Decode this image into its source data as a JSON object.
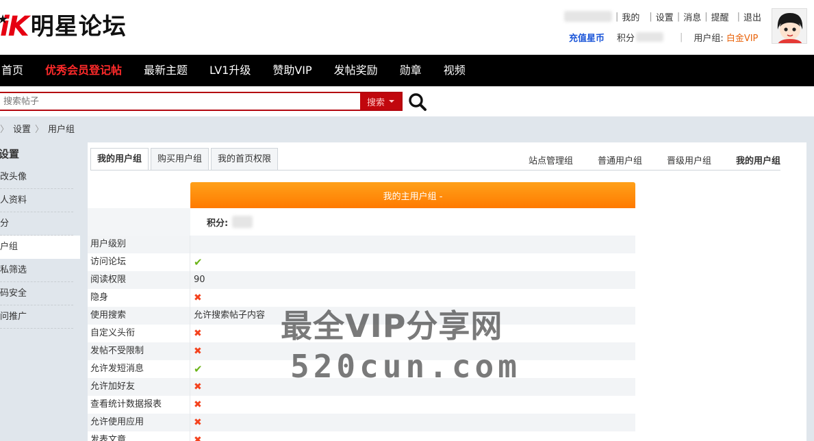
{
  "logo": {
    "mark": "iK",
    "text": "明星论坛"
  },
  "user_links": [
    "我的",
    "设置",
    "消息",
    "提醒",
    "退出"
  ],
  "user_line2": {
    "recharge": "充值星币",
    "credit_label": "积分",
    "group_label": "用户组:",
    "group_value": "白金VIP"
  },
  "nav": [
    "首页",
    "优秀会员登记帖",
    "最新主题",
    "LV1升级",
    "赞助VIP",
    "发帖奖励",
    "勋章",
    "视频"
  ],
  "search": {
    "placeholder": "搜索帖子",
    "button": "搜索"
  },
  "breadcrumb": [
    "设置",
    "用户组"
  ],
  "sidebar": {
    "title": "设置",
    "items": [
      "修改头像",
      "个人资料",
      "积分",
      "用户组",
      "隐私筛选",
      "密码安全",
      "访问推广"
    ],
    "active": "用户组"
  },
  "tabs": [
    "我的用户组",
    "购买用户组",
    "我的首页权限"
  ],
  "group_links": [
    "站点管理组",
    "普通用户组",
    "晋级用户组",
    "我的用户组"
  ],
  "table": {
    "header": "我的主用户组 -",
    "credit_label": "积分:",
    "rows": [
      {
        "label": "用户级别",
        "value": "",
        "type": "text"
      },
      {
        "label": "访问论坛",
        "value": "✔",
        "type": "ok"
      },
      {
        "label": "阅读权限",
        "value": "90",
        "type": "text"
      },
      {
        "label": "隐身",
        "value": "✖",
        "type": "no"
      },
      {
        "label": "使用搜索",
        "value": "允许搜索帖子内容",
        "type": "text"
      },
      {
        "label": "自定义头衔",
        "value": "✖",
        "type": "no"
      },
      {
        "label": "发帖不受限制",
        "value": "✖",
        "type": "no"
      },
      {
        "label": "允许发短消息",
        "value": "✔",
        "type": "ok"
      },
      {
        "label": "允许加好友",
        "value": "✖",
        "type": "no"
      },
      {
        "label": "查看统计数据报表",
        "value": "✖",
        "type": "no"
      },
      {
        "label": "允许使用应用",
        "value": "✖",
        "type": "no"
      },
      {
        "label": "发表文章",
        "value": "✖",
        "type": "no"
      }
    ]
  },
  "watermark": {
    "line1": "最全VIP分享网",
    "line2": "520cun.com"
  },
  "colors": {
    "nav_bg": "#000000",
    "highlight": "#ff2a2a",
    "search_border": "#b3070f",
    "header_orange": "#ff8c0a",
    "ok": "#6bb418",
    "no": "#f4421d",
    "vip": "#e9630b"
  }
}
